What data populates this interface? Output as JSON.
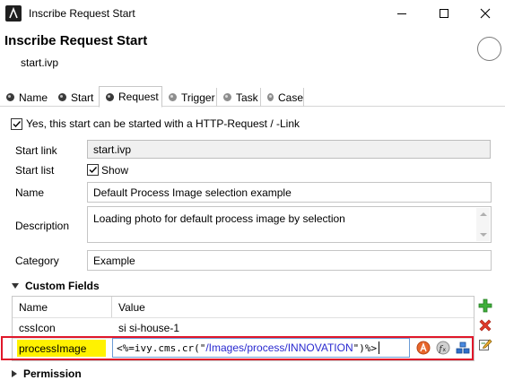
{
  "window": {
    "title": "Inscribe Request Start",
    "icons": [
      "axon-logo-icon",
      "minimize-icon",
      "maximize-icon",
      "close-icon"
    ]
  },
  "header": {
    "title": "Inscribe Request Start",
    "subtitle": "start.ivp"
  },
  "tabs": [
    {
      "label": "Name",
      "active": false
    },
    {
      "label": "Start",
      "active": false
    },
    {
      "label": "Request",
      "active": true
    },
    {
      "label": "Trigger",
      "active": false
    },
    {
      "label": "Task",
      "active": false
    },
    {
      "label": "Case",
      "active": false
    }
  ],
  "request": {
    "enable_label": "Yes, this start can be started with a HTTP-Request / -Link",
    "enable_checked": true,
    "start_link_label": "Start link",
    "start_link_value": "start.ivp",
    "start_list_label": "Start list",
    "show_label": "Show",
    "show_checked": true,
    "name_label": "Name",
    "name_value": "Default Process Image selection example",
    "description_label": "Description",
    "description_value": "Loading photo for default process image by selection",
    "category_label": "Category",
    "category_value": "Example"
  },
  "custom_fields": {
    "title": "Custom Fields",
    "columns": [
      "Name",
      "Value"
    ],
    "rows": [
      {
        "name": "cssIcon",
        "value": "si si-house-1"
      },
      {
        "name": "processImage",
        "value_prefix": "<%=ivy.cms.cr(\"",
        "value_string": "/Images/process/INNOVATION",
        "value_suffix": "\")%>"
      }
    ],
    "highlight_color": "#fff200",
    "selection_border_color": "#e0172a"
  },
  "permission": {
    "title": "Permission"
  }
}
